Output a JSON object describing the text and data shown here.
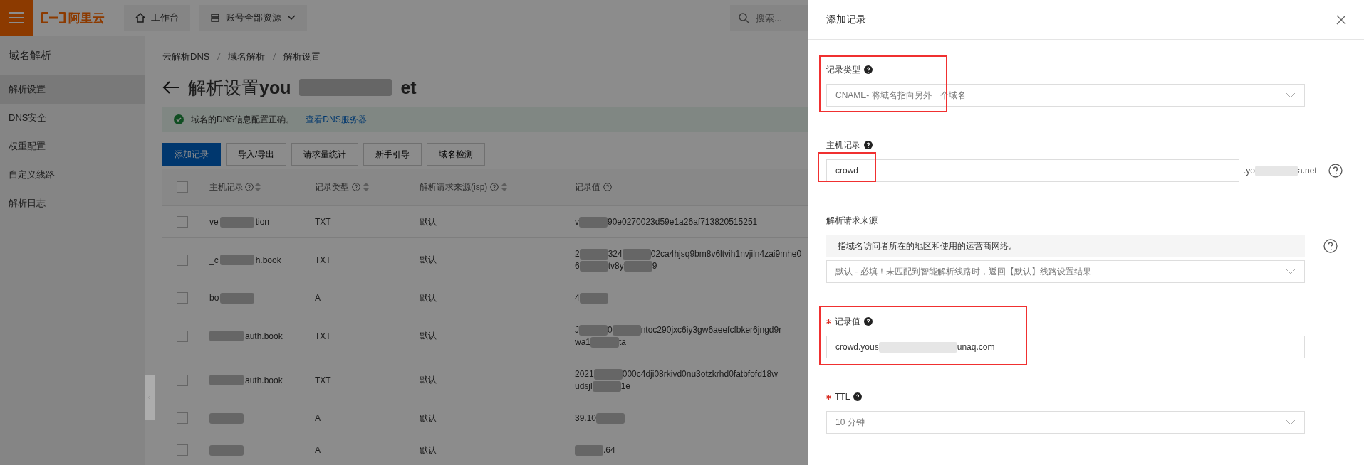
{
  "topbar": {
    "logo": "阿里云",
    "workbench": "工作台",
    "resources": "账号全部资源",
    "search_placeholder": "搜索..."
  },
  "sidebar": {
    "title": "域名解析",
    "items": [
      {
        "label": "解析设置",
        "selected": true
      },
      {
        "label": "DNS安全",
        "selected": false
      },
      {
        "label": "权重配置",
        "selected": false
      },
      {
        "label": "自定义线路",
        "selected": false
      },
      {
        "label": "解析日志",
        "selected": false
      }
    ]
  },
  "breadcrumb": [
    "云解析DNS",
    "域名解析",
    "解析设置"
  ],
  "page_title": {
    "text": "解析设置",
    "domain_parts": [
      "you",
      "et"
    ]
  },
  "alert": {
    "message": "域名的DNS信息配置正确。",
    "link": "查看DNS服务器"
  },
  "toolbar": [
    {
      "label": "添加记录",
      "primary": true
    },
    {
      "label": "导入/导出",
      "primary": false
    },
    {
      "label": "请求量统计",
      "primary": false
    },
    {
      "label": "新手引导",
      "primary": false
    },
    {
      "label": "域名检测",
      "primary": false
    }
  ],
  "table": {
    "all_checked": false,
    "columns": [
      {
        "label": "主机记录",
        "sortable": true
      },
      {
        "label": "记录类型",
        "sortable": true
      },
      {
        "label": "解析请求来源(isp)",
        "sortable": true
      },
      {
        "label": "记录值",
        "sortable": false
      }
    ],
    "rows": [
      {
        "checked": false,
        "host": [
          {
            "kind": "text",
            "text": "ve"
          },
          {
            "kind": "blur"
          },
          {
            "kind": "text",
            "text": "tion"
          }
        ],
        "type": "TXT",
        "isp": "默认",
        "value": [
          [
            {
              "kind": "text",
              "text": "v"
            },
            {
              "kind": "blur"
            },
            {
              "kind": "text",
              "text": "90e0270023d59e1a26af713820515251"
            }
          ]
        ]
      },
      {
        "checked": false,
        "host": [
          {
            "kind": "text",
            "text": "_c"
          },
          {
            "kind": "blur"
          },
          {
            "kind": "text",
            "text": "h.book"
          }
        ],
        "type": "TXT",
        "isp": "默认",
        "value": [
          [
            {
              "kind": "text",
              "text": "2"
            },
            {
              "kind": "blur"
            },
            {
              "kind": "text",
              "text": "324"
            },
            {
              "kind": "blur"
            },
            {
              "kind": "text",
              "text": "02ca4hjsq9bm8v6ltvih1nvjiln4zai9mhe0"
            }
          ],
          [
            {
              "kind": "text",
              "text": "6"
            },
            {
              "kind": "blur"
            },
            {
              "kind": "text",
              "text": "tv8y"
            },
            {
              "kind": "blur"
            },
            {
              "kind": "text",
              "text": "9"
            }
          ]
        ]
      },
      {
        "checked": false,
        "host": [
          {
            "kind": "text",
            "text": "bo"
          },
          {
            "kind": "blur"
          }
        ],
        "type": "A",
        "isp": "默认",
        "value": [
          [
            {
              "kind": "text",
              "text": "4"
            },
            {
              "kind": "blur"
            }
          ]
        ]
      },
      {
        "checked": false,
        "host": [
          {
            "kind": "blur"
          },
          {
            "kind": "text",
            "text": "auth.book"
          }
        ],
        "type": "TXT",
        "isp": "默认",
        "value": [
          [
            {
              "kind": "text",
              "text": "J"
            },
            {
              "kind": "blur"
            },
            {
              "kind": "text",
              "text": "0"
            },
            {
              "kind": "blur"
            },
            {
              "kind": "text",
              "text": "ntoc290jxc6iy3gw6aeefcfbker6jngd9r"
            }
          ],
          [
            {
              "kind": "text",
              "text": "wa1"
            },
            {
              "kind": "blur"
            },
            {
              "kind": "text",
              "text": "ta"
            }
          ]
        ]
      },
      {
        "checked": false,
        "host": [
          {
            "kind": "blur"
          },
          {
            "kind": "text",
            "text": "auth.book"
          }
        ],
        "type": "TXT",
        "isp": "默认",
        "value": [
          [
            {
              "kind": "text",
              "text": "2021"
            },
            {
              "kind": "blur"
            },
            {
              "kind": "text",
              "text": "000c4dji08rkivd0nu3otzkrhd0fatbfofd18w"
            }
          ],
          [
            {
              "kind": "text",
              "text": "udsjl"
            },
            {
              "kind": "blur"
            },
            {
              "kind": "text",
              "text": "1e"
            }
          ]
        ]
      },
      {
        "checked": false,
        "host": [
          {
            "kind": "blur"
          }
        ],
        "type": "A",
        "isp": "默认",
        "value": [
          [
            {
              "kind": "text",
              "text": "39.10"
            },
            {
              "kind": "blur"
            }
          ]
        ]
      },
      {
        "checked": false,
        "host": [
          {
            "kind": "blur"
          }
        ],
        "type": "A",
        "isp": "默认",
        "value": [
          [
            {
              "kind": "blur"
            },
            {
              "kind": "text",
              "text": ".64"
            }
          ]
        ]
      }
    ]
  },
  "drawer": {
    "title": "添加记录",
    "fields": [
      {
        "kind": "select",
        "label": "记录类型",
        "required": false,
        "help": true,
        "value": "CNAME- 将域名指向另外一个域名",
        "highlighted": true
      },
      {
        "kind": "input",
        "label": "主机记录",
        "required": false,
        "help": true,
        "value": "crowd",
        "suffix": [
          ".yo",
          "a.net"
        ],
        "highlighted": true
      },
      {
        "kind": "select",
        "label": "解析请求来源",
        "required": false,
        "help": false,
        "note": "指域名访问者所在的地区和使用的运营商网络。",
        "value": "默认 - 必填！未匹配到智能解析线路时，返回【默认】线路设置结果",
        "highlighted": false
      },
      {
        "kind": "input",
        "label": "记录值",
        "required": true,
        "help": true,
        "value": "crowd.yous",
        "value_tail": "unaq.com",
        "highlighted": true
      },
      {
        "kind": "select",
        "label": "TTL",
        "required": true,
        "help": true,
        "value": "10 分钟",
        "highlighted": false
      }
    ]
  }
}
